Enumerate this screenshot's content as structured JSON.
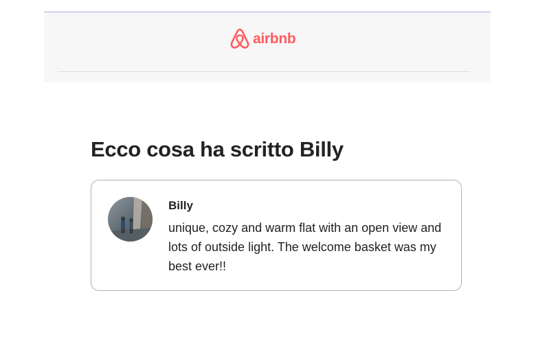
{
  "header": {
    "logo_icon": "airbnb-belo-icon",
    "logo_text": "airbnb",
    "brand_color": "#ff5a5f"
  },
  "main": {
    "heading": "Ecco cosa ha scritto Billy"
  },
  "review": {
    "avatar_icon": "user-avatar-photo",
    "author": "Billy",
    "text": "unique, cozy and warm flat with an open view and lots of outside light. The welcome basket was my best ever!!"
  }
}
